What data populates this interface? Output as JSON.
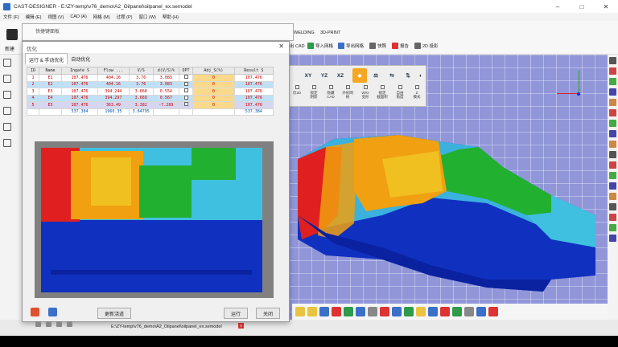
{
  "app": {
    "title": "CAST-DESIGNER - E:\\ZY-temp\\v76_demo\\A2_Oilpanel\\oilpanel_ex.semodel",
    "minimize": "–",
    "maximize": "□",
    "close": "✕"
  },
  "menu": [
    "文件 (F)",
    "编辑 (E)",
    "视图 (V)",
    "CAD (A)",
    "网格 (M)",
    "过程 (P)",
    "窗口 (W)",
    "帮助 (H)"
  ],
  "ribbon": {
    "new_label": "新建",
    "net_label": "网",
    "tab_welding": "WELDING",
    "tab_3dprint": "3D-PRINT",
    "items": [
      "出 CAD",
      "导入网格",
      "导出网格",
      "快照",
      "报告",
      "2D 投影"
    ]
  },
  "bg_dialog": {
    "title": "快捷键面板"
  },
  "dialog": {
    "title": "优化",
    "close": "✕",
    "tabs": [
      "运行 & 手动优化",
      "自动优化"
    ],
    "columns": [
      "ID",
      "Name",
      "Ingate S",
      "Flow ...",
      "V/S",
      "d(V/S)%",
      "OPT",
      "Adj_S(%)",
      "Result S"
    ],
    "rows": [
      {
        "id": "1",
        "name": "E1",
        "ingate": "107.476",
        "flow": "404.16",
        "vs": "3.76",
        "dvs": "3.083",
        "adj": "0",
        "result": "107.476"
      },
      {
        "id": "2",
        "name": "E2",
        "ingate": "107.476",
        "flow": "404.16",
        "vs": "3.76",
        "dvs": "3.083",
        "adj": "0",
        "result": "107.476"
      },
      {
        "id": "3",
        "name": "E3",
        "ingate": "107.476",
        "flow": "394.244",
        "vs": "3.668",
        "dvs": "0.554",
        "adj": "0",
        "result": "107.476"
      },
      {
        "id": "4",
        "name": "E4",
        "ingate": "107.476",
        "flow": "394.297",
        "vs": "3.669",
        "dvs": "0.567",
        "adj": "0",
        "result": "107.476"
      },
      {
        "id": "5",
        "name": "E5",
        "ingate": "107.476",
        "flow": "363.49",
        "vs": "3.382",
        "dvs": "-7.289",
        "adj": "0",
        "result": "107.476"
      }
    ],
    "summary": {
      "ingate": "537.384",
      "flow": "1960.35",
      "vs": "3.64795",
      "result": "537.384"
    },
    "buttons": {
      "update": "更新浇道",
      "run": "运行",
      "close": "关闭"
    }
  },
  "view_toolbar": {
    "buttons": [
      "XY",
      "YZ",
      "XZ",
      "",
      "",
      "",
      "",
      "",
      ""
    ],
    "options": [
      "仅2D",
      "锁定\n阴影",
      "隐藏\nCAD",
      "外形网\n格",
      "W/O\n变形",
      "锁定\n截面积",
      "自由\n角度",
      "Z\n模式"
    ]
  },
  "status": {
    "path": "E:\\ZY-temp\\v76_demo\\A2_Oilpanel\\oilpanel_ex.semodel",
    "close": "x"
  },
  "colors": {
    "adj_cell": "#fbd98a",
    "row_highlight": "#bfe0f7",
    "viewport_bg": "#9096d8",
    "zone_red": "#e02020",
    "zone_orange": "#f0a010",
    "zone_green": "#22b030",
    "zone_cyan": "#40c0e0",
    "zone_blue": "#1030c0"
  }
}
